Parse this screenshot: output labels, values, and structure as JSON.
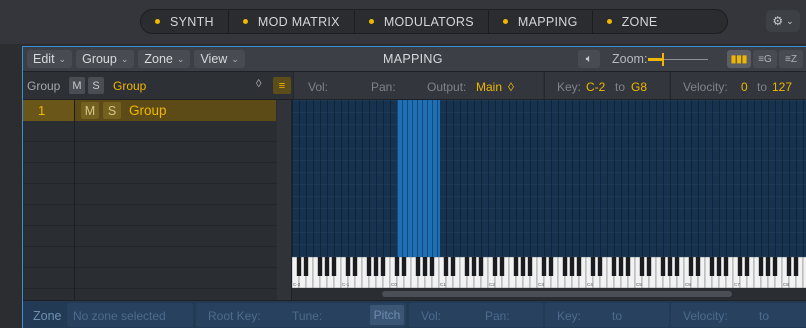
{
  "tabs": [
    {
      "label": "SYNTH"
    },
    {
      "label": "MOD MATRIX"
    },
    {
      "label": "MODULATORS"
    },
    {
      "label": "MAPPING"
    },
    {
      "label": "ZONE"
    }
  ],
  "gear": {
    "icon": "gear-icon",
    "chevron": "v"
  },
  "menubar": {
    "menus": [
      {
        "label": "Edit"
      },
      {
        "label": "Group"
      },
      {
        "label": "Zone"
      },
      {
        "label": "View"
      }
    ],
    "title": "MAPPING",
    "speaker_icon": "speaker-icon",
    "zoom_label": "Zoom:",
    "zoom_level": 0.25,
    "view_buttons": [
      "keyboard-view-icon",
      "group-view-icon",
      "zone-view-icon"
    ]
  },
  "group_bar": {
    "label": "Group",
    "mute": "M",
    "solo": "S",
    "group_name": "Group",
    "stepper": "◊",
    "vol_label": "Vol:",
    "pan_label": "Pan:",
    "output_label": "Output:",
    "output_value": "Main",
    "output_stepper": "◊",
    "key_label": "Key:",
    "key_from": "C-2",
    "to_label": "to",
    "key_to": "G8",
    "velocity_label": "Velocity:",
    "velocity_from": "0",
    "velocity_to": "127"
  },
  "group_list": {
    "rows": [
      {
        "number": "1",
        "mute": "M",
        "solo": "S",
        "name": "Group"
      }
    ]
  },
  "keyboard": {
    "octave_labels": [
      "C-2",
      "C-1",
      "C0",
      "C1",
      "C2",
      "C3",
      "C4",
      "C5",
      "C6",
      "C7",
      "C8"
    ],
    "mapped_zone": {
      "start_key": "C0",
      "end_key": "A#0"
    }
  },
  "zone_bar": {
    "label": "Zone",
    "status": "No zone selected",
    "root_key_label": "Root Key:",
    "tune_label": "Tune:",
    "pitch_label": "Pitch",
    "vol_label": "Vol:",
    "pan_label": "Pan:",
    "key_label": "Key:",
    "to_label": "to",
    "velocity_label": "Velocity:",
    "velocity_to_label": "to"
  },
  "colors": {
    "accent": "#f0b700",
    "selection": "#3a8fd9",
    "zone": "#1f6fb4"
  }
}
